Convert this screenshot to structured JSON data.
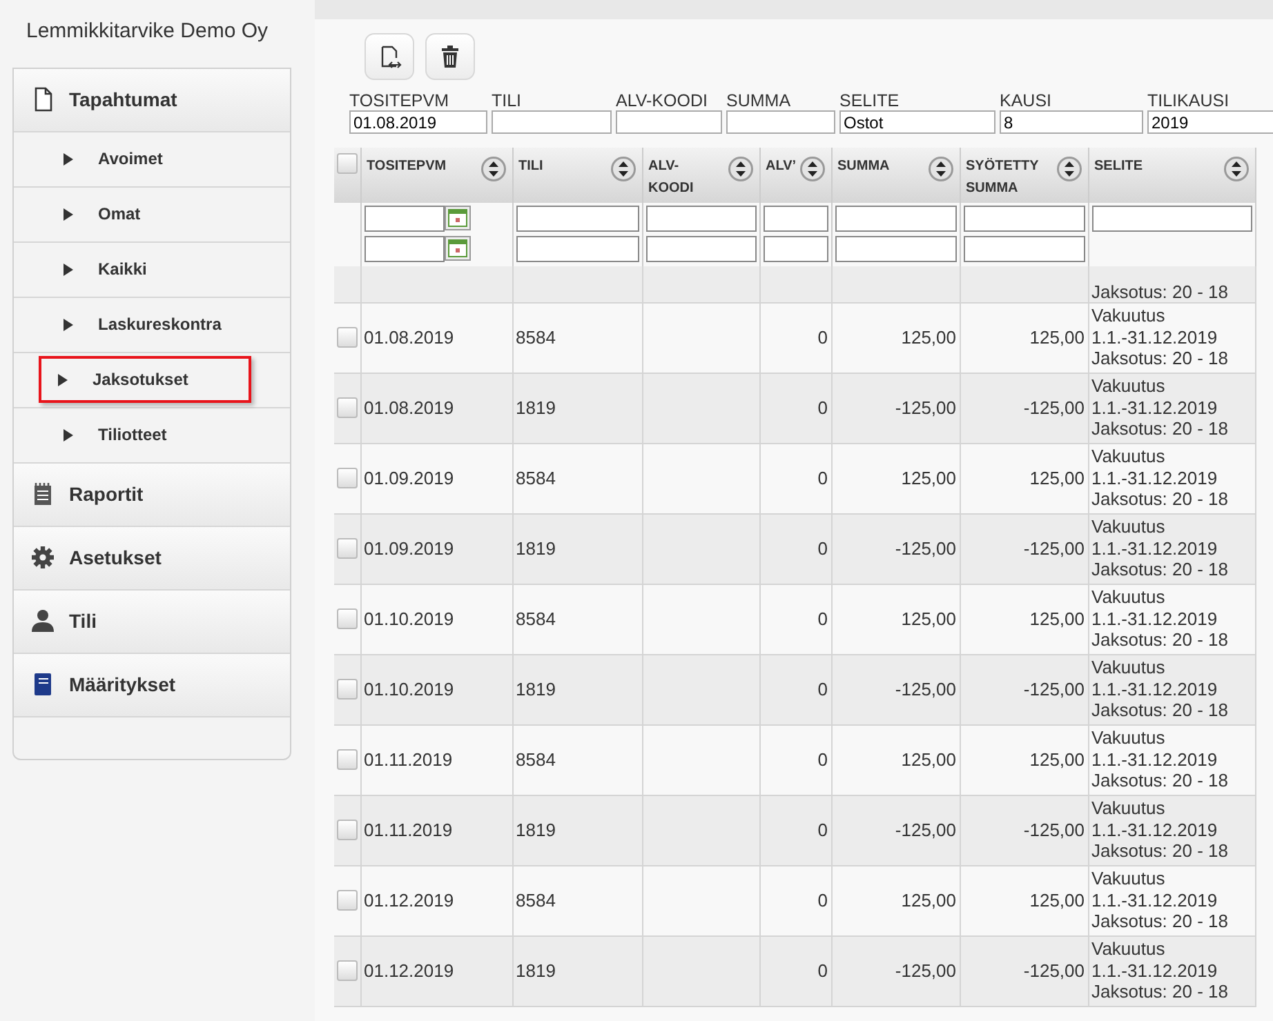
{
  "company": "Lemmikkitarvike Demo Oy",
  "sidebar": {
    "sections": [
      {
        "label": "Tapahtumat",
        "kind": "document",
        "children": [
          {
            "label": "Avoimet",
            "highlighted": false
          },
          {
            "label": "Omat",
            "highlighted": false
          },
          {
            "label": "Kaikki",
            "highlighted": false
          },
          {
            "label": "Laskureskontra",
            "highlighted": false
          },
          {
            "label": "Jaksotukset",
            "highlighted": true
          },
          {
            "label": "Tiliotteet",
            "highlighted": false
          }
        ]
      },
      {
        "label": "Raportit",
        "kind": "notepad"
      },
      {
        "label": "Asetukset",
        "kind": "gear"
      },
      {
        "label": "Tili",
        "kind": "person"
      },
      {
        "label": "Määritykset",
        "kind": "book"
      }
    ]
  },
  "toolbar": [
    {
      "kind": "document-arrows"
    },
    {
      "kind": "trash"
    }
  ],
  "form": [
    {
      "label": "TOSITEPVM",
      "value": "01.08.2019"
    },
    {
      "label": "TILI"
    },
    {
      "label": "ALV-KOODI"
    },
    {
      "label": "SUMMA"
    },
    {
      "label": "SELITE",
      "value": "Ostot"
    },
    {
      "label": "KAUSI",
      "value": "8"
    },
    {
      "label": "TILIKAUSI",
      "value": "2019"
    }
  ],
  "table": {
    "select_all_checked": false,
    "columns": [
      {
        "label": "TOSITEPVM",
        "kind": "date"
      },
      {
        "label": "TILI",
        "kind": "double"
      },
      {
        "label": "ALV-\nKOODI",
        "kind": "double"
      },
      {
        "label": "ALV’",
        "kind": "double"
      },
      {
        "label": "SUMMA",
        "kind": "double"
      },
      {
        "label": "SYÖTETTY\nSUMMA",
        "kind": "double"
      },
      {
        "label": "SELITE",
        "kind": "single"
      }
    ],
    "partial_row": {
      "selite": "Jaksotus: 20 - 18"
    },
    "rows": [
      {
        "checked": false,
        "cells": [
          "01.08.2019",
          "8584",
          "",
          "0",
          "125,00",
          "125,00"
        ],
        "selite": [
          "Vakuutus",
          "1.1.-31.12.2019",
          "Jaksotus: 20 - 18"
        ]
      },
      {
        "checked": false,
        "cells": [
          "01.08.2019",
          "1819",
          "",
          "0",
          "-125,00",
          "-125,00"
        ],
        "selite": [
          "Vakuutus",
          "1.1.-31.12.2019",
          "Jaksotus: 20 - 18"
        ]
      },
      {
        "checked": false,
        "cells": [
          "01.09.2019",
          "8584",
          "",
          "0",
          "125,00",
          "125,00"
        ],
        "selite": [
          "Vakuutus",
          "1.1.-31.12.2019",
          "Jaksotus: 20 - 18"
        ]
      },
      {
        "checked": false,
        "cells": [
          "01.09.2019",
          "1819",
          "",
          "0",
          "-125,00",
          "-125,00"
        ],
        "selite": [
          "Vakuutus",
          "1.1.-31.12.2019",
          "Jaksotus: 20 - 18"
        ]
      },
      {
        "checked": false,
        "cells": [
          "01.10.2019",
          "8584",
          "",
          "0",
          "125,00",
          "125,00"
        ],
        "selite": [
          "Vakuutus",
          "1.1.-31.12.2019",
          "Jaksotus: 20 - 18"
        ]
      },
      {
        "checked": false,
        "cells": [
          "01.10.2019",
          "1819",
          "",
          "0",
          "-125,00",
          "-125,00"
        ],
        "selite": [
          "Vakuutus",
          "1.1.-31.12.2019",
          "Jaksotus: 20 - 18"
        ]
      },
      {
        "checked": false,
        "cells": [
          "01.11.2019",
          "8584",
          "",
          "0",
          "125,00",
          "125,00"
        ],
        "selite": [
          "Vakuutus",
          "1.1.-31.12.2019",
          "Jaksotus: 20 - 18"
        ]
      },
      {
        "checked": false,
        "cells": [
          "01.11.2019",
          "1819",
          "",
          "0",
          "-125,00",
          "-125,00"
        ],
        "selite": [
          "Vakuutus",
          "1.1.-31.12.2019",
          "Jaksotus: 20 - 18"
        ]
      },
      {
        "checked": false,
        "cells": [
          "01.12.2019",
          "8584",
          "",
          "0",
          "125,00",
          "125,00"
        ],
        "selite": [
          "Vakuutus",
          "1.1.-31.12.2019",
          "Jaksotus: 20 - 18"
        ]
      },
      {
        "checked": false,
        "cells": [
          "01.12.2019",
          "1819",
          "",
          "0",
          "-125,00",
          "-125,00"
        ],
        "selite": [
          "Vakuutus",
          "1.1.-31.12.2019",
          "Jaksotus: 20 - 18"
        ]
      }
    ]
  }
}
